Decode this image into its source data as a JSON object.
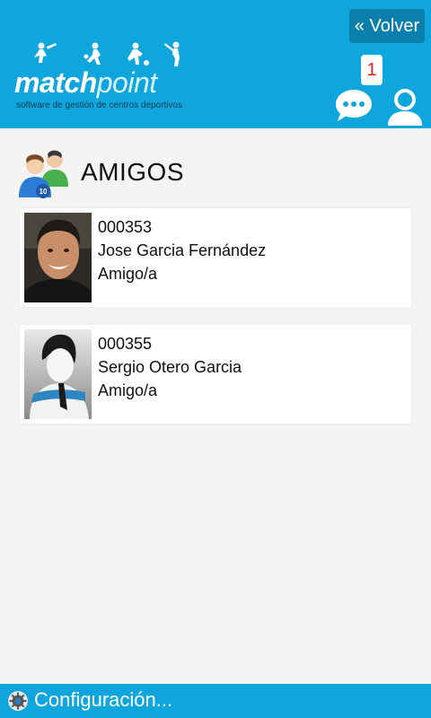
{
  "header": {
    "back_label": "« Volver",
    "logo_word1": "match",
    "logo_word2": "point",
    "logo_tagline": "software de gestión de centros deportivos",
    "notification_count": "1",
    "accent_color": "#0ea6dd"
  },
  "section": {
    "title": "AMIGOS",
    "icon": "friends-group-icon"
  },
  "friends": [
    {
      "id": "000353",
      "name": "Jose Garcia Fernández",
      "relation": "Amigo/a",
      "avatar": "photo"
    },
    {
      "id": "000355",
      "name": "Sergio Otero Garcia",
      "relation": "Amigo/a",
      "avatar": "default-silhouette"
    }
  ],
  "footer": {
    "label": "Configuración...",
    "icon": "gear-icon"
  }
}
